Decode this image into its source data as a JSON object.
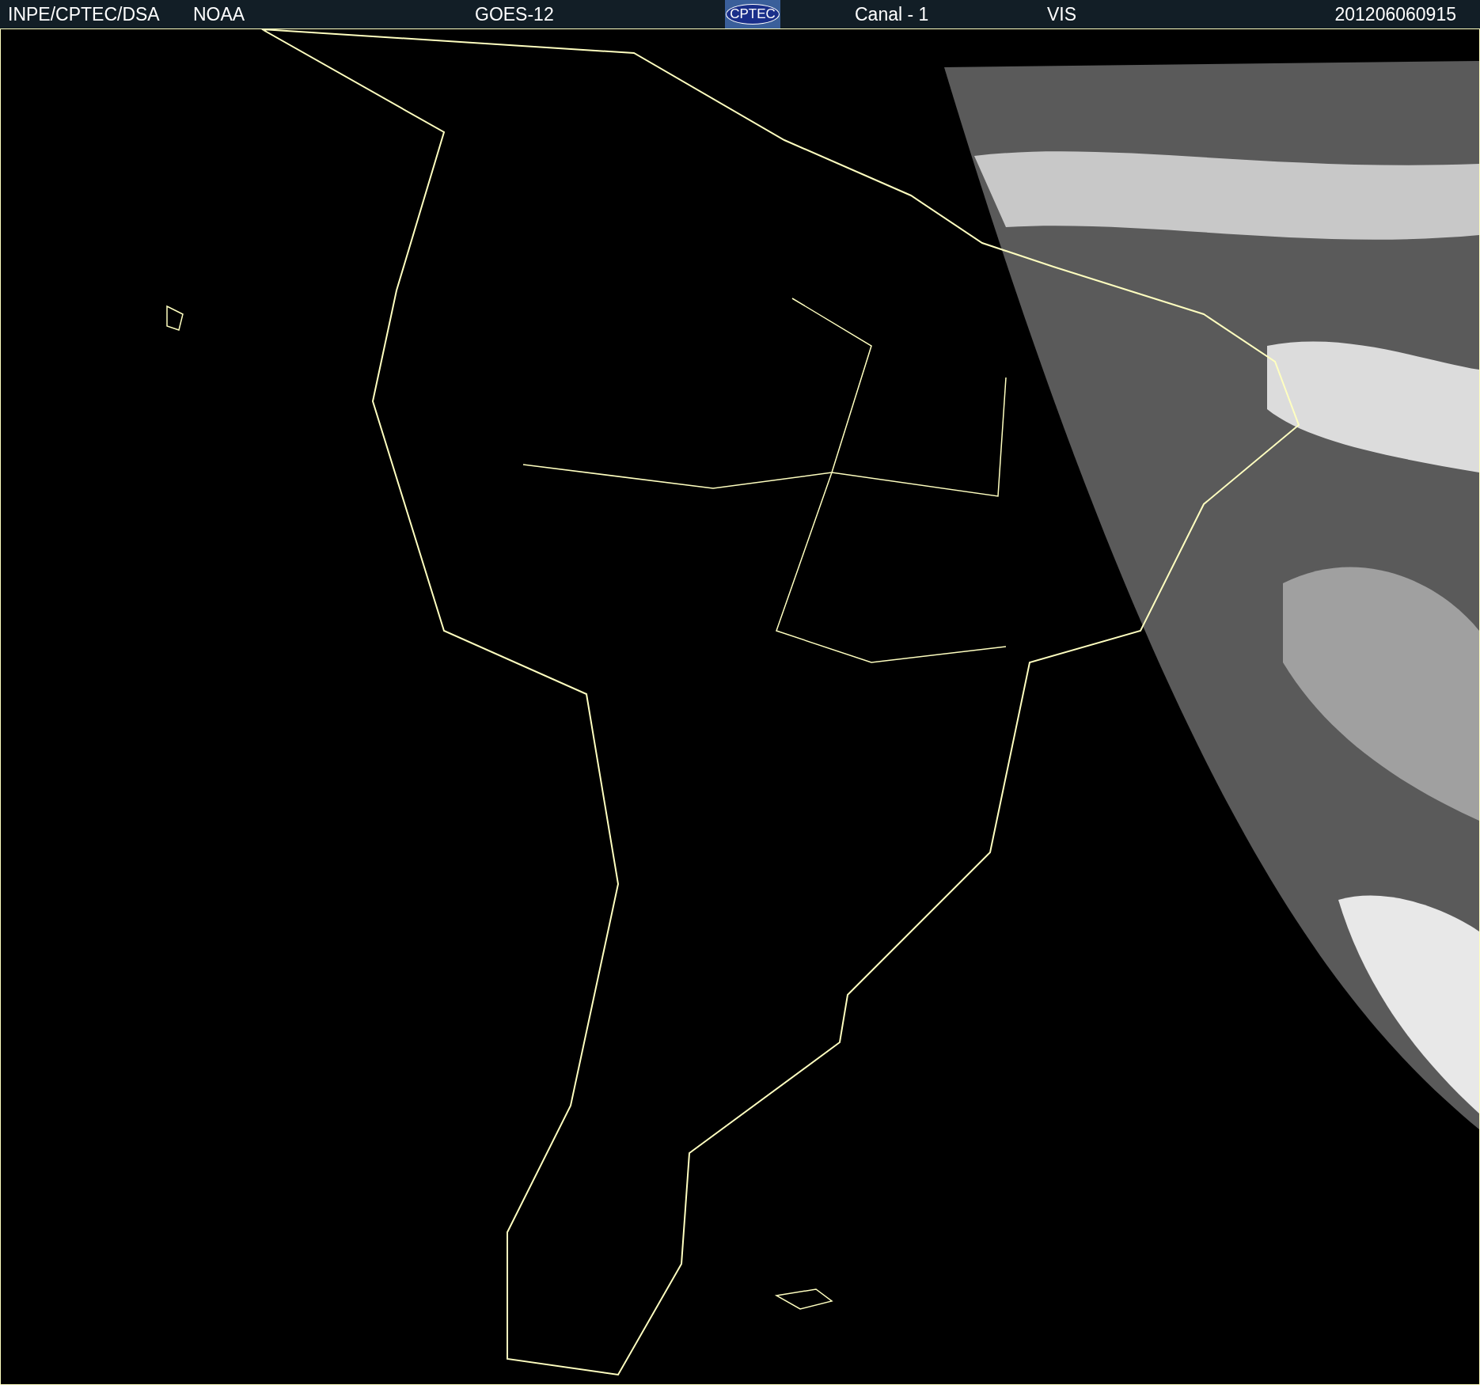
{
  "header": {
    "source": "INPE/CPTEC/DSA",
    "agency": "NOAA",
    "satellite": "GOES-12",
    "logo": "CPTEC",
    "channel": "Canal - 1",
    "band": "VIS",
    "timestamp": "201206060915"
  }
}
